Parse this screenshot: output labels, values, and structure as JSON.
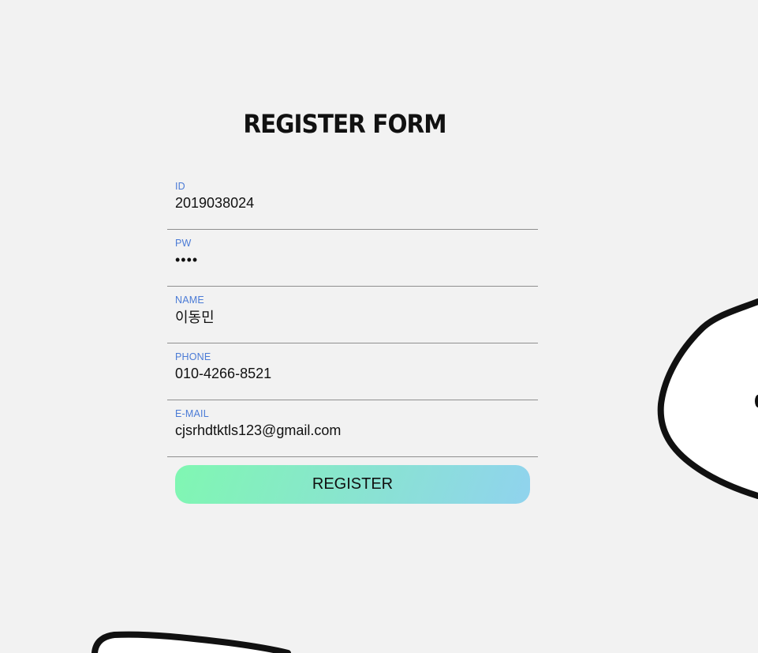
{
  "form": {
    "title": "REGISTER FORM",
    "fields": [
      {
        "label": "ID",
        "value": "2019038024"
      },
      {
        "label": "PW",
        "value": "••••"
      },
      {
        "label": "NAME",
        "value": "이동민"
      },
      {
        "label": "PHONE",
        "value": "010-4266-8521"
      },
      {
        "label": "E-MAIL",
        "value": "cjsrhdtktls123@gmail.com"
      }
    ],
    "submit_label": "REGISTER"
  },
  "colors": {
    "label": "#4b7bd6",
    "button_gradient_start": "#80f7b2",
    "button_gradient_end": "#90d3ee",
    "background": "#f2f2f2"
  }
}
